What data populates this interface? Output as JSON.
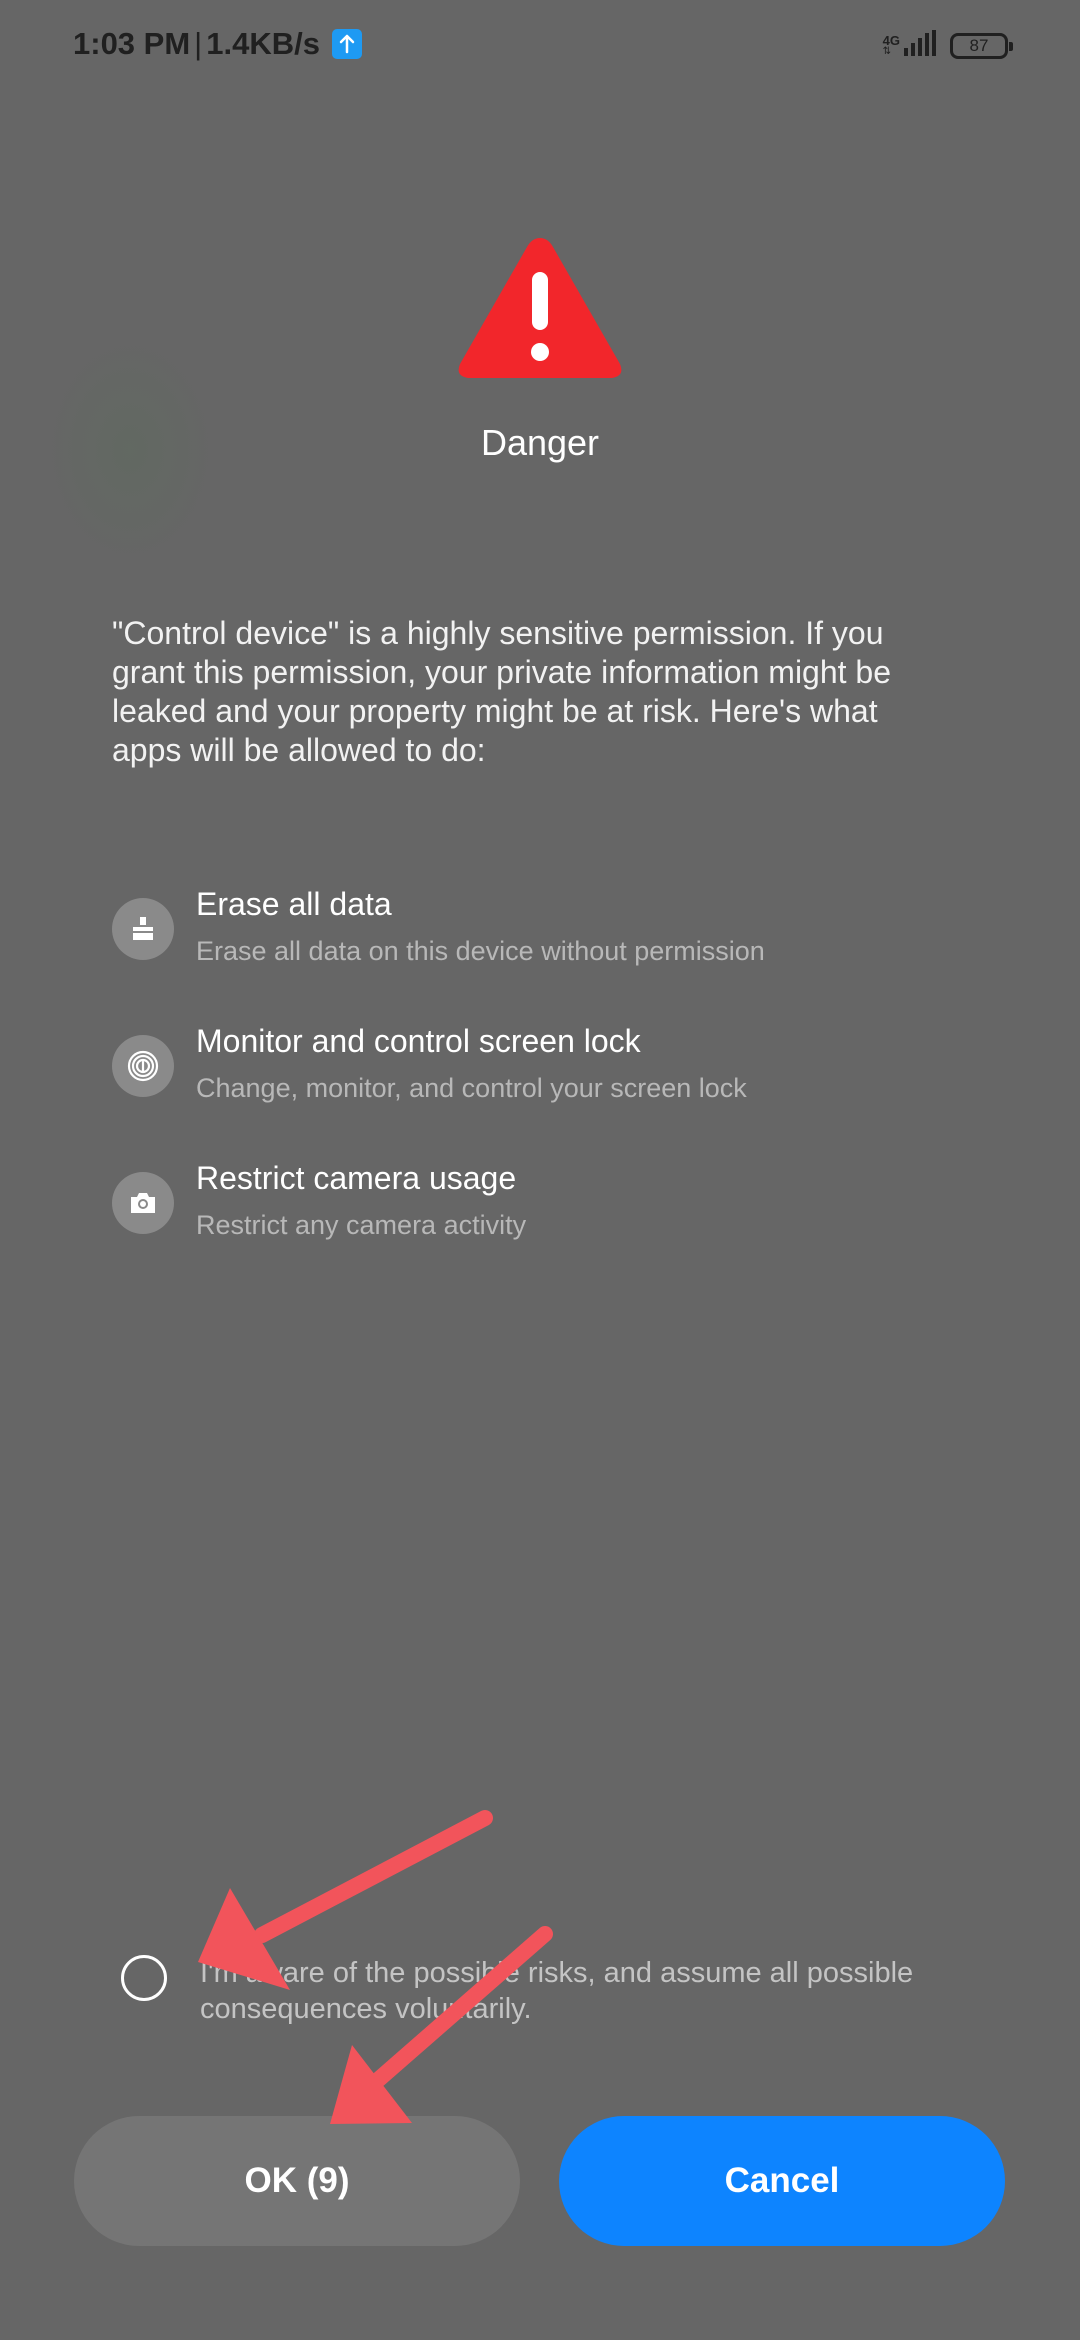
{
  "status_bar": {
    "time": "1:03 PM",
    "separator": "|",
    "speed": "1.4KB/s",
    "network": "4G",
    "battery": "87"
  },
  "dialog": {
    "title": "Danger",
    "description": "\"Control device\" is a highly sensitive permission. If you grant this permission, your private information might be leaked and your property might be at risk. Here's what apps will be allowed to do:",
    "permissions": [
      {
        "icon": "erase-icon",
        "title": "Erase all data",
        "description": "Erase all data on this device without permission"
      },
      {
        "icon": "fingerprint-icon",
        "title": "Monitor and control screen lock",
        "description": "Change, monitor, and control your screen lock"
      },
      {
        "icon": "camera-icon",
        "title": "Restrict camera usage",
        "description": "Restrict any camera activity"
      }
    ],
    "consent_text": "I'm aware of the possible risks, and assume all possible consequences voluntarily.",
    "ok_label": "OK (9)",
    "cancel_label": "Cancel"
  },
  "colors": {
    "background": "#666666",
    "danger": "#f2262b",
    "ok_button": "#757575",
    "cancel_button": "#0d84ff",
    "annotation_arrow": "#f2545b"
  }
}
